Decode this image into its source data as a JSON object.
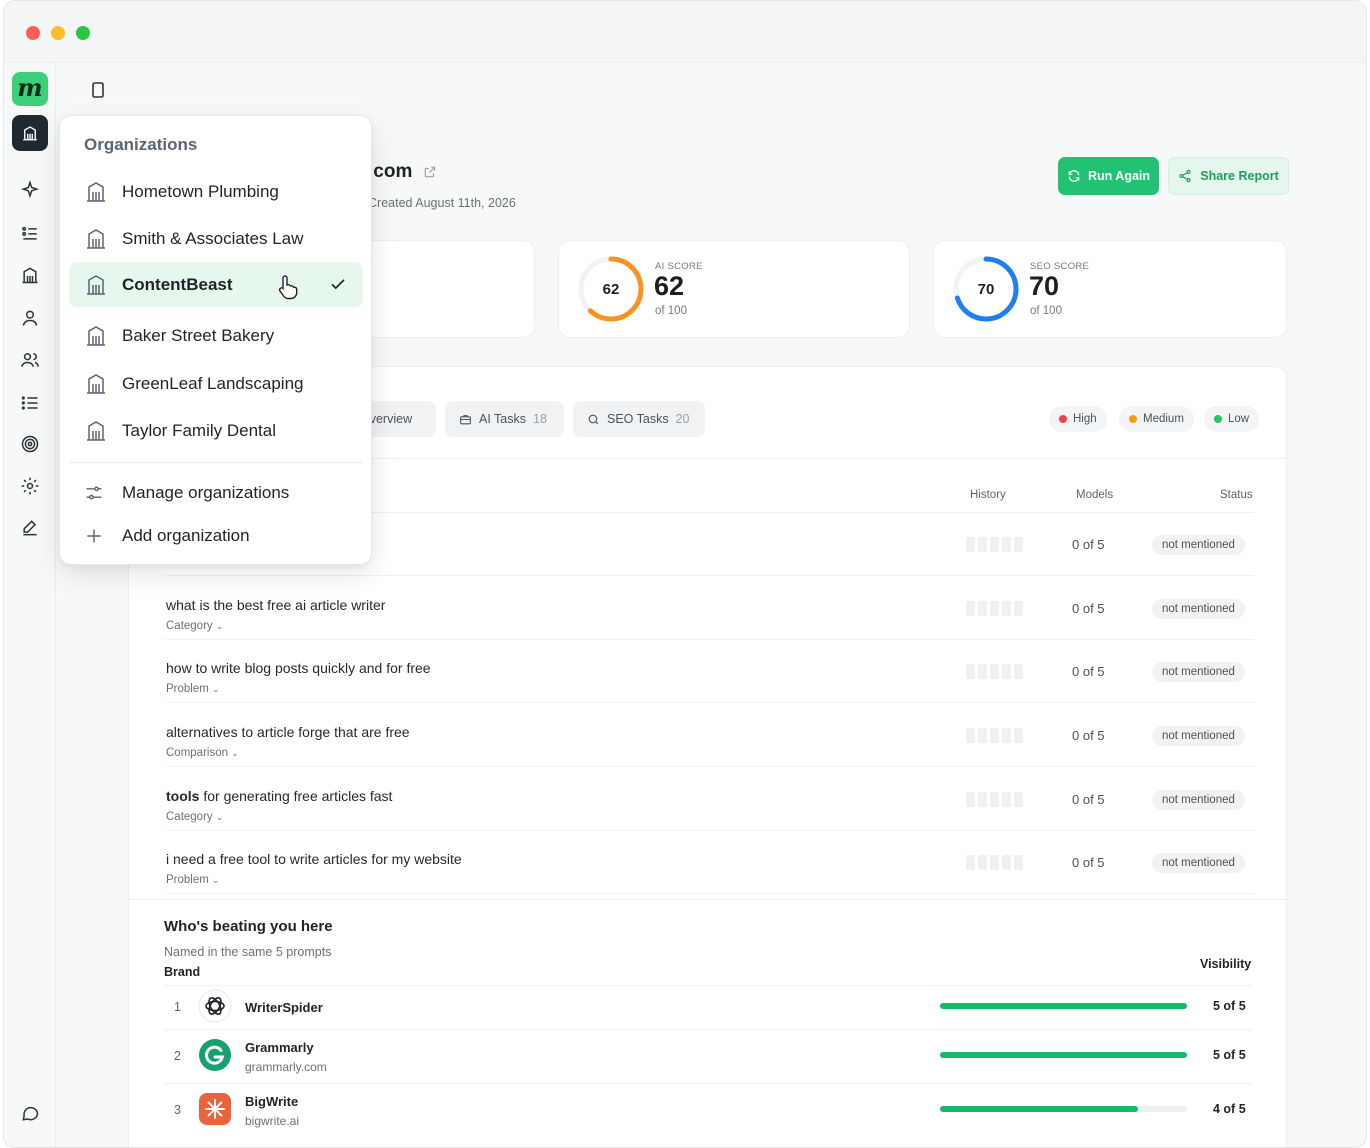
{
  "site": {
    "title_suffix": ".com",
    "created": "Created August 11th, 2026"
  },
  "actions": {
    "run_again": "Run Again",
    "share_report": "Share Report"
  },
  "scores": [
    {
      "label": "AI SCORE",
      "value": "62",
      "of": "of 100",
      "fraction": 0.62,
      "color": "#f7931e"
    },
    {
      "label": "SEO SCORE",
      "value": "70",
      "of": "of 100",
      "fraction": 0.7,
      "color": "#1f7ff0"
    }
  ],
  "tabs": {
    "overview": {
      "label": "Overview"
    },
    "ai_tasks": {
      "label": "AI Tasks",
      "count": "18"
    },
    "seo_tasks": {
      "label": "SEO Tasks",
      "count": "20"
    }
  },
  "priority": {
    "high": {
      "label": "High",
      "color": "#ef4444"
    },
    "medium": {
      "label": "Medium",
      "color": "#f59e0b"
    },
    "low": {
      "label": "Low",
      "color": "#22c55e"
    }
  },
  "columns": {
    "history": "History",
    "models": "Models",
    "status": "Status"
  },
  "prompts": [
    {
      "bold": "",
      "text": "",
      "category": "",
      "models": "0 of 5",
      "status": "not mentioned"
    },
    {
      "bold": "",
      "text": "what is the best free ai article writer",
      "category": "Category",
      "models": "0 of 5",
      "status": "not mentioned"
    },
    {
      "bold": "",
      "text": "how to write blog posts quickly and for free",
      "category": "Problem",
      "models": "0 of 5",
      "status": "not mentioned"
    },
    {
      "bold": "",
      "text": "alternatives to article forge that are free",
      "category": "Comparison",
      "models": "0 of 5",
      "status": "not mentioned"
    },
    {
      "bold": "tools",
      "text": " for generating free articles fast",
      "category": "Category",
      "models": "0 of 5",
      "status": "not mentioned"
    },
    {
      "bold": "",
      "text": "i need a free tool to write articles for my website",
      "category": "Problem",
      "models": "0 of 5",
      "status": "not mentioned"
    }
  ],
  "competitors": {
    "title": "Who's beating you here",
    "subtitle": "Named in the same 5 prompts",
    "brand_header": "Brand",
    "visibility_header": "Visibility",
    "rows": [
      {
        "rank": "1",
        "name": "WriterSpider",
        "domain": "",
        "score": "5 of 5",
        "fraction": 1.0,
        "logo": "openai-icon"
      },
      {
        "rank": "2",
        "name": "Grammarly",
        "domain": "grammarly.com",
        "score": "5 of 5",
        "fraction": 1.0,
        "logo": "grammarly-icon"
      },
      {
        "rank": "3",
        "name": "BigWrite",
        "domain": "bigwrite.ai",
        "score": "4 of 5",
        "fraction": 0.8,
        "logo": "burst-icon"
      }
    ]
  },
  "org_menu": {
    "heading": "Organizations",
    "items": [
      {
        "label": "Hometown Plumbing"
      },
      {
        "label": "Smith & Associates Law"
      },
      {
        "label": "ContentBeast",
        "active": true
      },
      {
        "label": "Baker Street Bakery"
      },
      {
        "label": "GreenLeaf Landscaping"
      },
      {
        "label": "Taylor Family Dental"
      }
    ],
    "manage": "Manage organizations",
    "add": "Add organization"
  },
  "colors": {
    "accent": "#22c272",
    "active_bg": "#e6f7ed"
  }
}
